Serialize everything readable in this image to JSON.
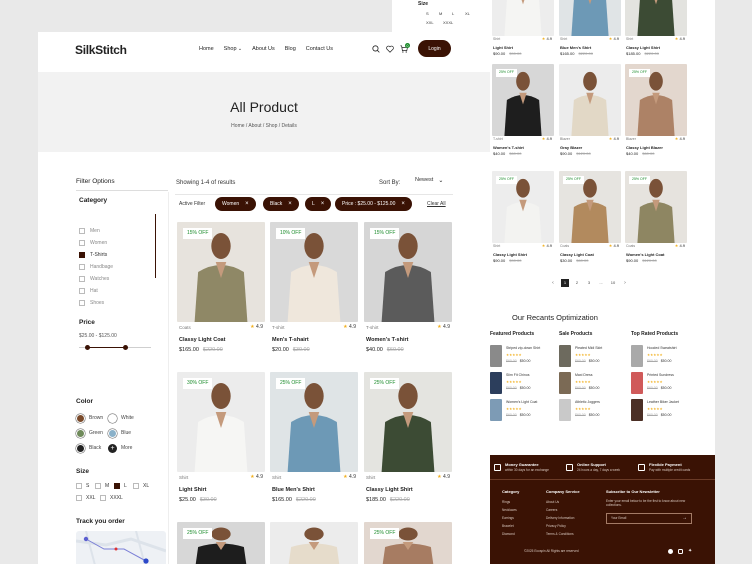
{
  "size_strip": {
    "title": "Size",
    "sizes_row1": [
      "S",
      "M",
      "L",
      "XL"
    ],
    "sizes_row2": [
      "XXL",
      "XXXL"
    ]
  },
  "header": {
    "logo": "SilkStitch",
    "nav": [
      "Home",
      "Shop",
      "About Us",
      "Blog",
      "Contact Us"
    ],
    "login": "Login",
    "cart_count": "0"
  },
  "hero": {
    "title": "All Product",
    "breadcrumb": [
      "Home /",
      "About /",
      "Shop /",
      "Details"
    ]
  },
  "sidebar": {
    "title": "Filter Options",
    "category_title": "Category",
    "categories": [
      {
        "label": "Men",
        "checked": false
      },
      {
        "label": "Women",
        "checked": false
      },
      {
        "label": "T-Shirts",
        "checked": true
      },
      {
        "label": "Handbage",
        "checked": false
      },
      {
        "label": "Watches",
        "checked": false
      },
      {
        "label": "Hat",
        "checked": false
      },
      {
        "label": "Shoes",
        "checked": false
      }
    ],
    "price_title": "Price",
    "price_range": "$25.00 - $125.00",
    "price_low_fraction": 0.12,
    "price_high_fraction": 0.65,
    "color_title": "Color",
    "colors": [
      {
        "label": "Brown",
        "hex": "#7a4a2a"
      },
      {
        "label": "White",
        "hex": "#ffffff"
      },
      {
        "label": "Green",
        "hex": "#6f8a5a"
      },
      {
        "label": "Blue",
        "hex": "#8ab1c9"
      },
      {
        "label": "Black",
        "hex": "#222222"
      },
      {
        "label": "More",
        "hex": "#222222"
      }
    ],
    "size_title": "Size",
    "sizes_row1": [
      {
        "label": "S",
        "checked": false
      },
      {
        "label": "M",
        "checked": false
      },
      {
        "label": "L",
        "checked": true
      },
      {
        "label": "XL",
        "checked": false
      }
    ],
    "sizes_row2": [
      {
        "label": "XXL",
        "checked": false
      },
      {
        "label": "XXXL",
        "checked": false
      }
    ],
    "track_title": "Track you order"
  },
  "toolbar": {
    "results": "Showing 1-4 of results",
    "sort_label": "Sort By:",
    "sort_value": "Newest",
    "active_filter_label": "Active Filter",
    "filters": [
      "Women",
      "Black",
      "L",
      "Price : $25.00 - $125.00"
    ],
    "clear_all": "Clear All"
  },
  "products": [
    {
      "badge": "15% OFF",
      "category": "Coats",
      "rating": "4.9",
      "name": "Classy Light Coat",
      "price": "$165.00",
      "old_price": "$220.00",
      "bg": "#e7e3dd",
      "fg": "#8f8866"
    },
    {
      "badge": "10% OFF",
      "category": "T-shirt",
      "rating": "4.9",
      "name": "Men's T-shairt",
      "price": "$20.00",
      "old_price": "$30.00",
      "bg": "#d9d9d9",
      "fg": "#efe7dc"
    },
    {
      "badge": "15% OFF",
      "category": "T-shirt",
      "rating": "4.9",
      "name": "Women's T-shirt",
      "price": "$40.00",
      "old_price": "$60.00",
      "bg": "#d6d6d6",
      "fg": "#5b5b5b"
    },
    {
      "badge": "30% OFF",
      "category": "Shirt",
      "rating": "4.9",
      "name": "Light Shirt",
      "price": "$25.00",
      "old_price": "$30.00",
      "bg": "#ececec",
      "fg": "#f6f6f4"
    },
    {
      "badge": "25% OFF",
      "category": "Shirt",
      "rating": "4.9",
      "name": "Blue Men's Shirt",
      "price": "$165.00",
      "old_price": "$220.00",
      "bg": "#dfe4e6",
      "fg": "#6d99b6"
    },
    {
      "badge": "25% OFF",
      "category": "Shirt",
      "rating": "4.9",
      "name": "Classy Light Shirt",
      "price": "$185.00",
      "old_price": "$220.00",
      "bg": "#e4e4e0",
      "fg": "#3c4b34"
    },
    {
      "badge": "25% OFF",
      "bg": "#d7d7d7",
      "fg": "#1d1d1d"
    },
    {
      "badge": "",
      "bg": "#ececec",
      "fg": "#e6dccb"
    },
    {
      "badge": "25% OFF",
      "bg": "#e2d7cf",
      "fg": "#a77c62"
    }
  ],
  "right_products": [
    {
      "badge": "",
      "category": "Shirt",
      "rating": "4.9",
      "name": "Light Shirt",
      "price": "$90.00",
      "old_price": "$90.00",
      "bg": "#ededed",
      "fg": "#f5f5f3"
    },
    {
      "badge": "",
      "category": "Shirt",
      "rating": "4.9",
      "name": "Blue Men's Shirt",
      "price": "$165.00",
      "old_price": "$220.00",
      "bg": "#e0e4e6",
      "fg": "#6d99b6"
    },
    {
      "badge": "",
      "category": "Shirt",
      "rating": "4.9",
      "name": "Classy Light Shirt",
      "price": "$185.00",
      "old_price": "$220.00",
      "bg": "#e3e3df",
      "fg": "#3c4b34"
    },
    {
      "badge": "25% OFF",
      "category": "T-shirt",
      "rating": "4.9",
      "name": "Women's T-shirt",
      "price": "$40.00",
      "old_price": "$60.00",
      "bg": "#d7d7d7",
      "fg": "#1e1e1e"
    },
    {
      "badge": "",
      "category": "Blazer",
      "rating": "4.9",
      "name": "Gray Blazer",
      "price": "$90.00",
      "old_price": "$120.00",
      "bg": "#ececec",
      "fg": "#e2d8c6"
    },
    {
      "badge": "25% OFF",
      "category": "Blazer",
      "rating": "4.9",
      "name": "Classy Light Blazer",
      "price": "$40.00",
      "old_price": "$60.00",
      "bg": "#e3d7ce",
      "fg": "#ad8266"
    },
    {
      "badge": "25% OFF",
      "category": "Shirt",
      "rating": "4.9",
      "name": "Classy Light Shirt",
      "price": "$90.00",
      "old_price": "$90.00",
      "bg": "#ededed",
      "fg": "#f3f3f1"
    },
    {
      "badge": "25% OFF",
      "category": "Coats",
      "rating": "4.9",
      "name": "Classy Light Coat",
      "price": "$30.00",
      "old_price": "$60.00",
      "bg": "#e6e4e0",
      "fg": "#b28a5e"
    },
    {
      "badge": "25% OFF",
      "category": "Coats",
      "rating": "4.9",
      "name": "Women's Light Coat",
      "price": "$90.00",
      "old_price": "$120.00",
      "bg": "#e6e3de",
      "fg": "#8e8662"
    }
  ],
  "pagination": {
    "prev": "‹",
    "pages": [
      "1",
      "2",
      "3",
      "...",
      "10"
    ],
    "next": "›",
    "active": 0
  },
  "optimization": {
    "title": "Our Recants Optimization",
    "columns": [
      {
        "title": "Featured Products",
        "items": [
          {
            "name": "Striped zip-down Shirt",
            "price": "$50.00",
            "old": "$60.00",
            "color": "#8a8a8a"
          },
          {
            "name": "Slim Fit Chinos",
            "price": "$50.00",
            "old": "$60.00",
            "color": "#2c3e5c"
          },
          {
            "name": "Women's Light Coat",
            "price": "$50.00",
            "old": "$60.00",
            "color": "#7d9bb5"
          }
        ]
      },
      {
        "title": "Sale Products",
        "items": [
          {
            "name": "Pleated Midi Skirt",
            "price": "$50.00",
            "old": "$60.00",
            "color": "#6d6a5e"
          },
          {
            "name": "Maxi Dress",
            "price": "$50.00",
            "old": "$60.00",
            "color": "#7b6a55"
          },
          {
            "name": "Athletic Joggers",
            "price": "$50.00",
            "old": "$60.00",
            "color": "#c9c9c9"
          }
        ]
      },
      {
        "title": "Top Rated Products",
        "items": [
          {
            "name": "Hooded Sweatshirt",
            "price": "$50.00",
            "old": "$60.00",
            "color": "#a9a9a9"
          },
          {
            "name": "Printed Sundress",
            "price": "$50.00",
            "old": "$60.00",
            "color": "#d05a5a"
          },
          {
            "name": "Leather Biker Jacket",
            "price": "$50.00",
            "old": "$60.00",
            "color": "#4b2f25"
          }
        ]
      }
    ]
  },
  "footer": {
    "features": [
      {
        "title": "Money Guarantee",
        "sub": "within 30 days for an exchange"
      },
      {
        "title": "Online Support",
        "sub": "24 hours a day, 7 days a week"
      },
      {
        "title": "Flexible Payment",
        "sub": "Pay with multiple credit cards"
      }
    ],
    "col1_title": "Category",
    "col1": [
      "Rings",
      "Necklaces",
      "Earrings",
      "Bracelet",
      "Diamond"
    ],
    "col2_title": "Company Service",
    "col2": [
      "About Us",
      "Careers",
      "Delivery Information",
      "Privacy Policy",
      "Terms & Conditions"
    ],
    "newsletter_title": "Subscribe to Our Newsletter",
    "newsletter_text": "Enter your email below to be the first to know about new collections.",
    "email_placeholder": "Your Email",
    "copyright": "©2025 Ecospin All Rights are reserved"
  },
  "colors": {
    "accent": "#3a1204",
    "badge_green": "#1a8b2a",
    "star": "#f2b01e"
  }
}
